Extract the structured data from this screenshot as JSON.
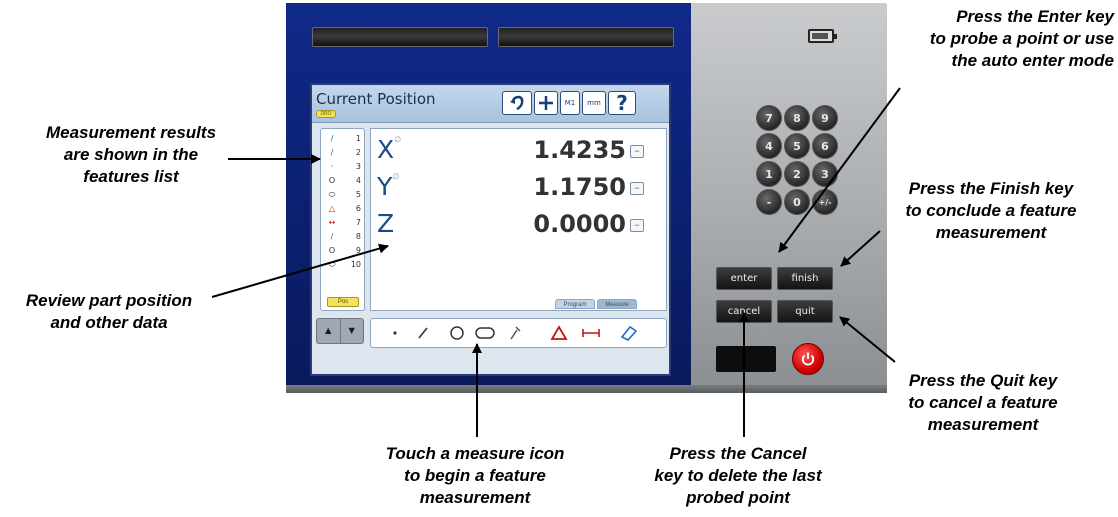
{
  "device": {
    "screen": {
      "title": "Current Position",
      "dro_tag": "DRO",
      "pos_tag": "Pos",
      "header_buttons": [
        "M1",
        "mm"
      ],
      "features": [
        {
          "num": "1",
          "icon": "line-icon"
        },
        {
          "num": "2",
          "icon": "line-icon"
        },
        {
          "num": "3",
          "icon": "point-icon"
        },
        {
          "num": "4",
          "icon": "circle-icon"
        },
        {
          "num": "5",
          "icon": "slot-icon"
        },
        {
          "num": "6",
          "icon": "angle-icon"
        },
        {
          "num": "7",
          "icon": "distance-icon"
        },
        {
          "num": "8",
          "icon": "line-icon"
        },
        {
          "num": "9",
          "icon": "circle-icon"
        },
        {
          "num": "10",
          "icon": "slot-icon"
        }
      ],
      "readout": {
        "x": {
          "label": "X",
          "value": "1.4235"
        },
        "y": {
          "label": "Y",
          "value": "1.1750"
        },
        "z": {
          "label": "Z",
          "value": "0.0000"
        }
      },
      "tabs": [
        "Program",
        "Measure"
      ],
      "measure_icons": [
        "point-icon",
        "line-icon",
        "circle-icon",
        "slot-icon",
        "probe-icon",
        "angle-icon",
        "distance-icon",
        "skew-icon"
      ]
    },
    "keypad": {
      "numbers": [
        "7",
        "8",
        "9",
        "4",
        "5",
        "6",
        "1",
        "2",
        "3",
        "-",
        "0",
        "+/-"
      ],
      "enter": "enter",
      "finish": "finish",
      "cancel": "cancel",
      "quit": "quit"
    }
  },
  "callouts": {
    "enter": "Press the Enter key\nto probe a point or use\nthe auto enter mode",
    "results": "Measurement results\nare shown in the\nfeatures list",
    "finish": "Press the Finish key\nto conclude a feature\nmeasurement",
    "review": "Review part position\nand other data",
    "quit": "Press the Quit key\nto cancel a feature\nmeasurement",
    "touch": "Touch a measure icon\nto begin a feature\nmeasurement",
    "cancel": "Press the Cancel\nkey to delete the last\nprobed point"
  },
  "colors": {
    "bezel": "#0b1f6e",
    "accent_yellow": "#f3e25a",
    "power_red": "#d30000"
  }
}
